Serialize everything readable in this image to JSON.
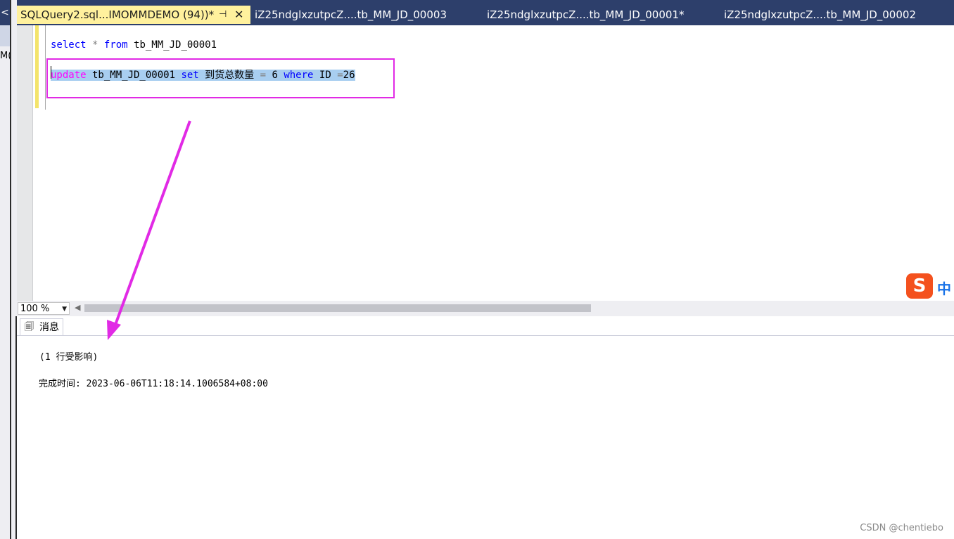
{
  "left_strip": {
    "top_glyph": "<",
    "fragment": "M("
  },
  "tabs": [
    {
      "label": "SQLQuery2.sql...IMOMMDEMO (94))*",
      "active": true,
      "pin": "⊣",
      "close": "✕"
    },
    {
      "label": "iZ25ndglxzutpcZ....tb_MM_JD_00003",
      "active": false
    },
    {
      "label": "iZ25ndglxzutpcZ....tb_MM_JD_00001*",
      "active": false
    },
    {
      "label": "iZ25ndglxzutpcZ....tb_MM_JD_00002",
      "active": false
    }
  ],
  "editor": {
    "line1": {
      "kw1": "select",
      "op": " * ",
      "kw2": "from",
      "rest": " tb_MM_JD_00001"
    },
    "line2": {
      "kw1": "update",
      "t1": " tb_MM_JD_00001 ",
      "kw2": "set",
      "t2": " 到货总数量 ",
      "op1": "=",
      "t3": " 6 ",
      "kw3": "where",
      "t4": " ID ",
      "op2": "=",
      "t5": "26"
    }
  },
  "zoom": {
    "value": "100 %"
  },
  "messages_tab": {
    "label": "消息"
  },
  "messages": {
    "line1": "(1 行受影响)",
    "line2": "完成时间: 2023-06-06T11:18:14.1006584+08:00"
  },
  "ime": {
    "logo": "S",
    "mode": "中"
  },
  "watermark": "CSDN @chentiebo",
  "colors": {
    "titlebar": "#2d3f6b",
    "active_tab": "#fff19d",
    "keyword": "#0000ff",
    "keyword_alt": "#ff00ff",
    "annotation": "#e12ae5",
    "selection": "#a8cef0"
  }
}
